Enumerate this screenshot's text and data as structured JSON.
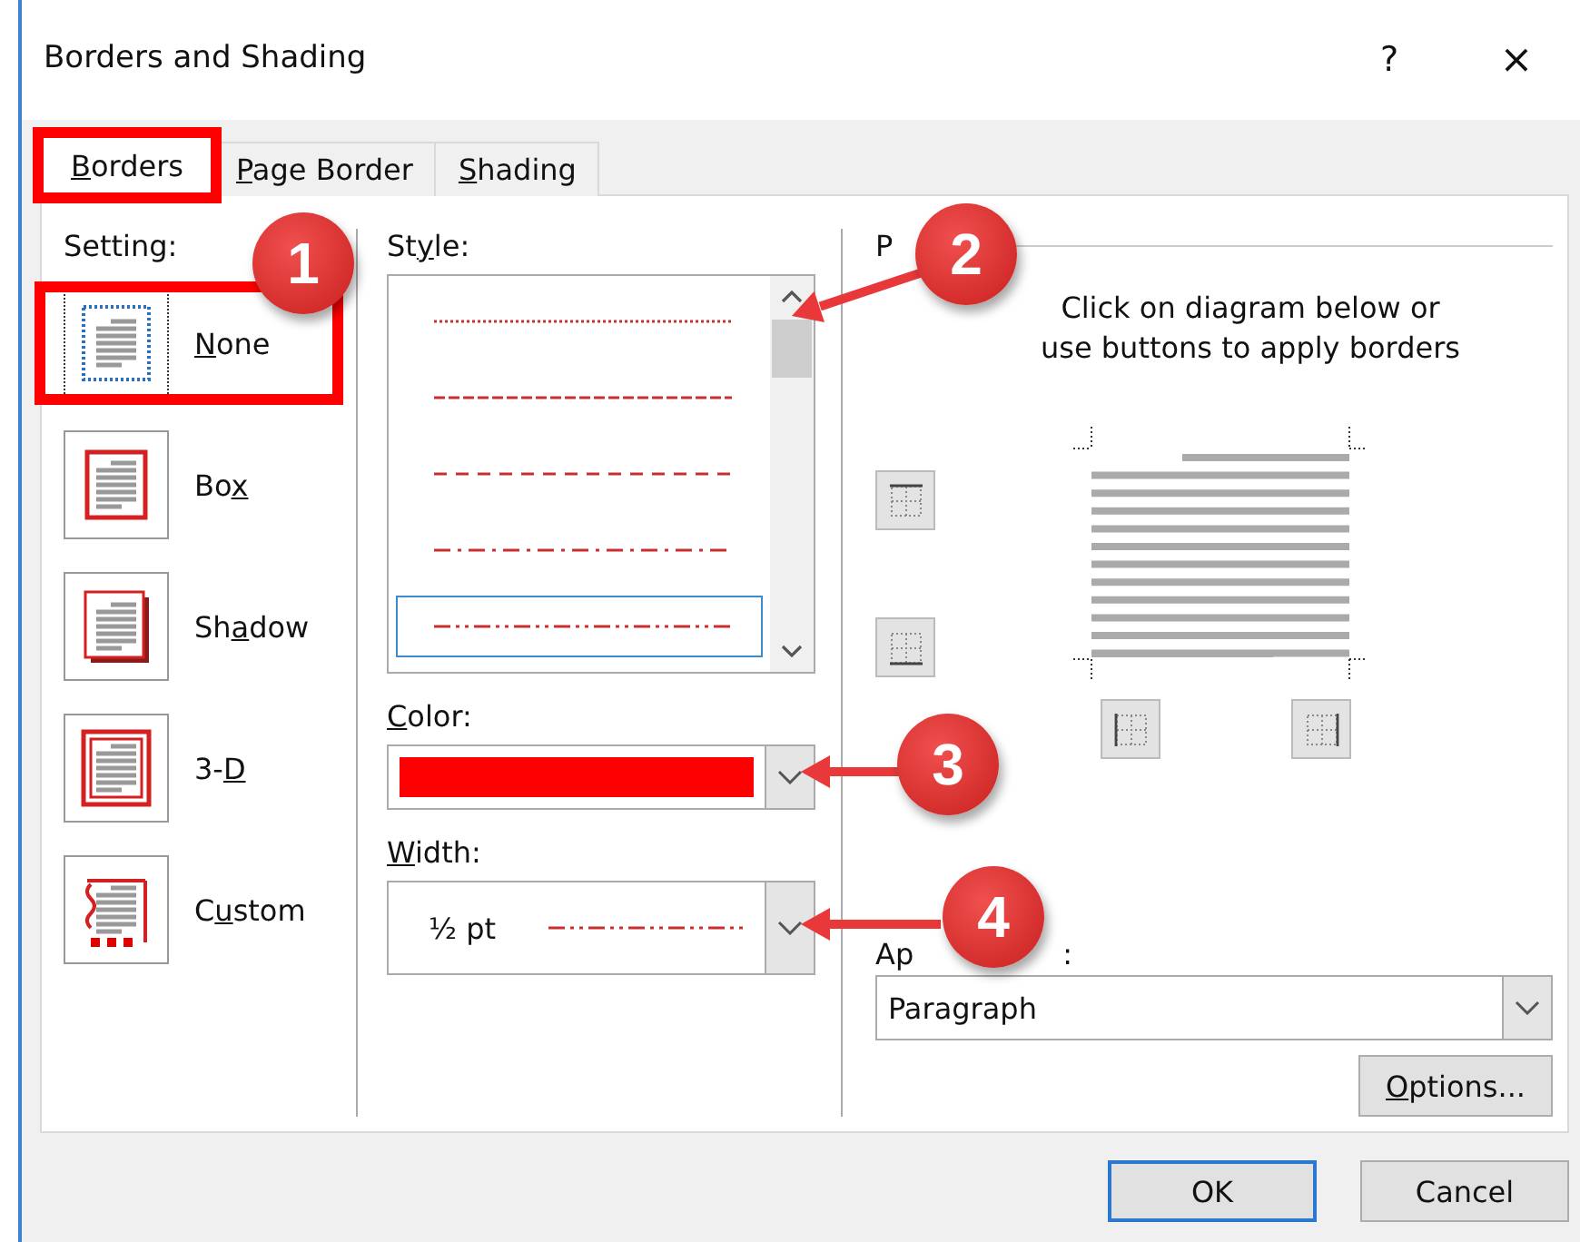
{
  "window": {
    "title": "Borders and Shading",
    "help": "?",
    "close": "×"
  },
  "tabs": [
    {
      "label": {
        "key": "B",
        "post": "orders"
      },
      "selected": true,
      "highlighted": true
    },
    {
      "label": {
        "key": "P",
        "post": "age Border"
      },
      "selected": false,
      "highlighted": false
    },
    {
      "label": {
        "key": "S",
        "post": "hading"
      },
      "selected": false,
      "highlighted": false
    }
  ],
  "setting": {
    "label": "Setting:",
    "items": [
      {
        "kind": "none",
        "label": {
          "key": "N",
          "post": "one"
        },
        "selected": true,
        "highlighted": true
      },
      {
        "kind": "box",
        "label": {
          "pre": "Bo",
          "key": "x"
        },
        "selected": false,
        "highlighted": false
      },
      {
        "kind": "shadow",
        "label": {
          "pre": "Sh",
          "key": "a",
          "post": "dow"
        },
        "selected": false,
        "highlighted": false
      },
      {
        "kind": "threed",
        "label": {
          "pre": "3-",
          "key": "D"
        },
        "selected": false,
        "highlighted": false
      },
      {
        "kind": "custom",
        "label": {
          "pre": "C",
          "key": "u",
          "post": "stom"
        },
        "selected": false,
        "highlighted": false
      }
    ]
  },
  "style": {
    "label": {
      "pre": "St",
      "key": "y",
      "post": "le:"
    },
    "items": [
      {
        "kind": "dotted",
        "selected": false
      },
      {
        "kind": "finedash",
        "selected": false
      },
      {
        "kind": "dashed",
        "selected": false
      },
      {
        "kind": "dashdot",
        "selected": false
      },
      {
        "kind": "dashdotdot",
        "selected": true
      }
    ]
  },
  "color": {
    "label": {
      "key": "C",
      "post": "olor:"
    },
    "color": "#ff0000"
  },
  "width": {
    "label": {
      "key": "W",
      "post": "idth:"
    },
    "value": "½ pt",
    "kind": "dashdotdot"
  },
  "preview": {
    "label": "P",
    "instructions": [
      "Click on diagram below or",
      "use buttons to apply borders"
    ],
    "border_buttons": [
      {
        "kind": "top"
      },
      {
        "kind": "bottom"
      },
      {
        "kind": "left"
      },
      {
        "kind": "right"
      }
    ]
  },
  "apply_to": {
    "label": "Ap",
    "label_end": ":",
    "value": "Paragraph"
  },
  "options_button": {
    "label": {
      "key": "O",
      "post": "ptions..."
    }
  },
  "buttons": [
    {
      "label": "OK",
      "default": true
    },
    {
      "label": "Cancel",
      "default": false
    }
  ],
  "callouts": [
    {
      "number": "1"
    },
    {
      "number": "2"
    },
    {
      "number": "3"
    },
    {
      "number": "4"
    }
  ]
}
